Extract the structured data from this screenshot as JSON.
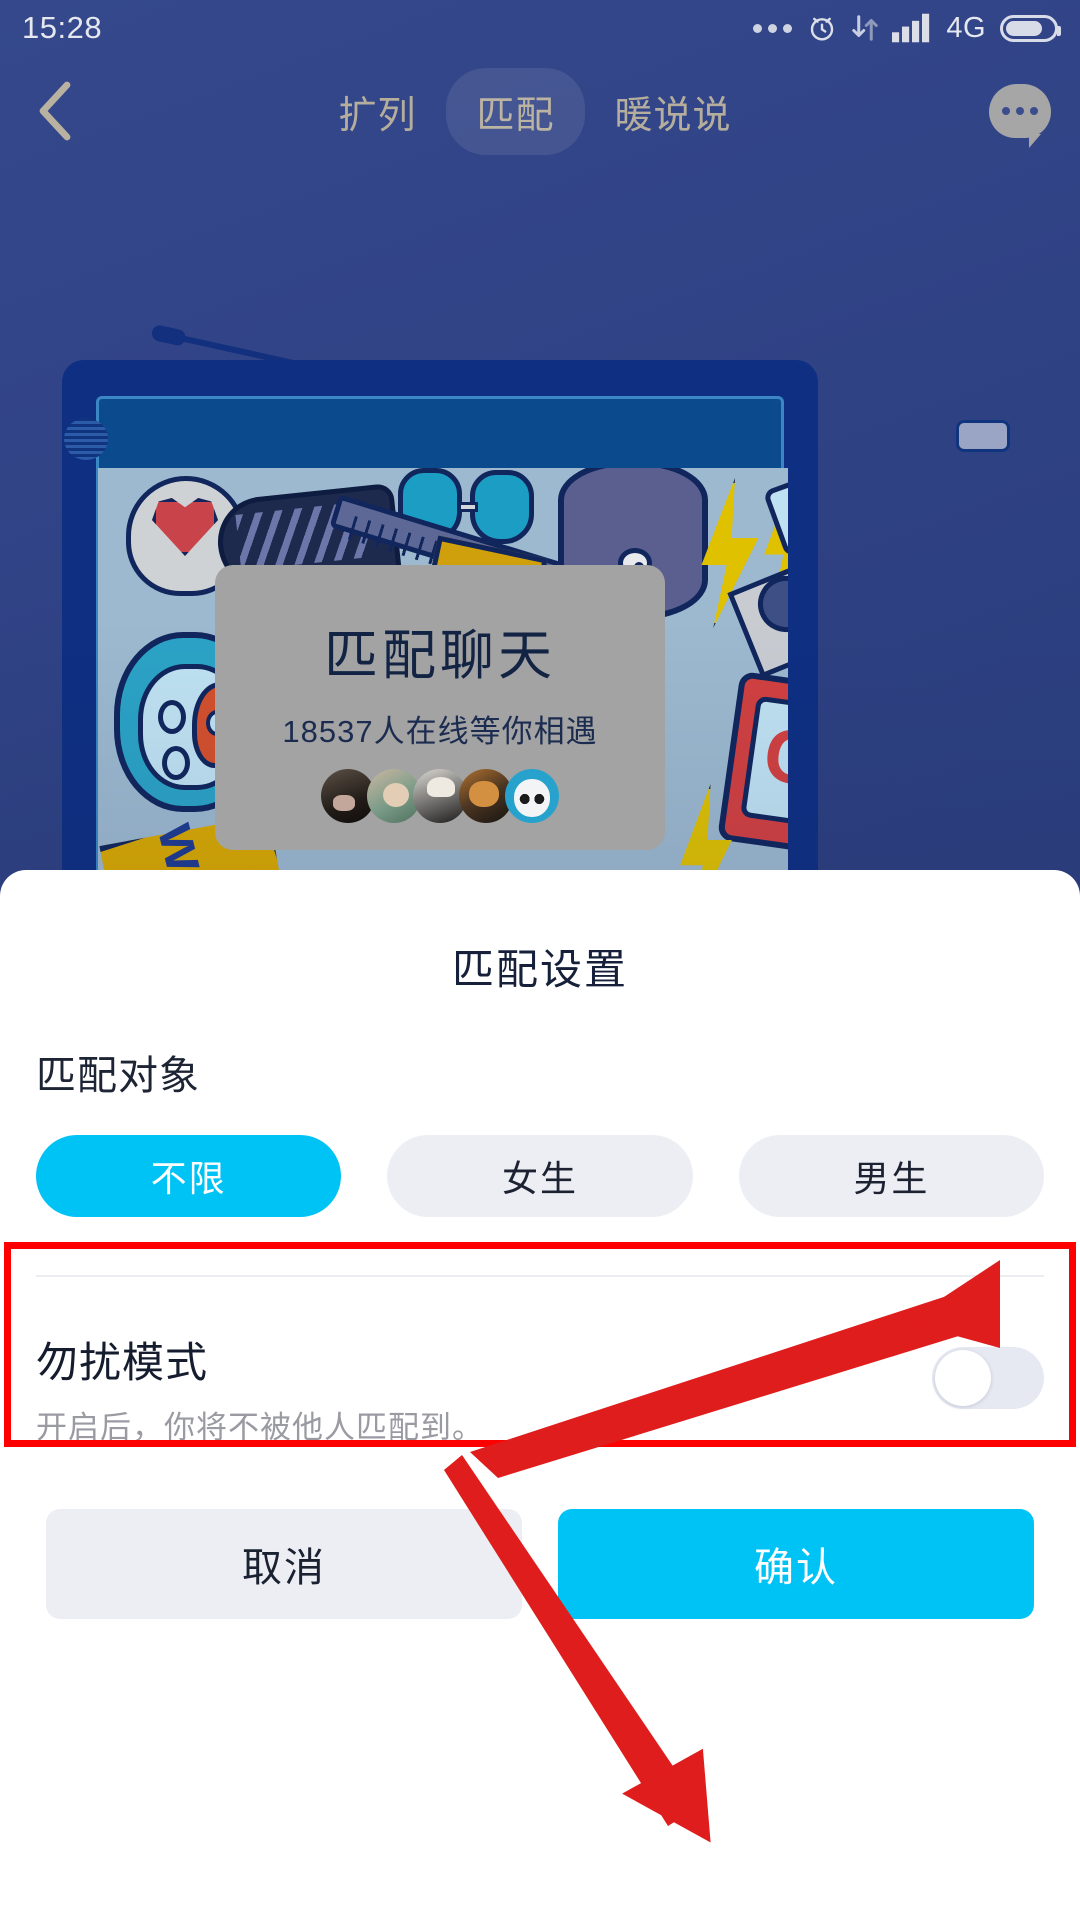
{
  "status_bar": {
    "time": "15:28",
    "icons": [
      "more-dots-icon",
      "alarm-clock-icon",
      "data-transfer-icon",
      "signal-bars-icon",
      "battery-icon"
    ],
    "network": "4G"
  },
  "nav": {
    "back_icon": "back-chevron-icon",
    "more_icon": "chat-bubble-more-icon",
    "tabs": [
      {
        "label": "扩列",
        "active": false
      },
      {
        "label": "匹配",
        "active": true
      },
      {
        "label": "暖说说",
        "active": false
      }
    ]
  },
  "promo_card": {
    "title": "匹配聊天",
    "subtitle": "18537人在线等你相遇",
    "online_count": "18537",
    "avatar_count": 5
  },
  "sheet": {
    "title": "匹配设置",
    "match_target": {
      "label": "匹配对象",
      "options": [
        {
          "label": "不限",
          "selected": true
        },
        {
          "label": "女生",
          "selected": false
        },
        {
          "label": "男生",
          "selected": false
        }
      ]
    },
    "dnd": {
      "title": "勿扰模式",
      "subtitle": "开启后，你将不被他人匹配到。",
      "enabled": false
    },
    "buttons": {
      "cancel": "取消",
      "confirm": "确认"
    }
  },
  "colors": {
    "accent_cyan": "#00c3f5",
    "chip_idle": "#eceef3",
    "annotation_red": "#fe0000",
    "arrow_red": "#e01d1d",
    "app_bg_blue": "#2e4183",
    "sheet_bg": "#ffffff"
  },
  "annotations": {
    "highlight_box": "match-target-section",
    "arrow_targets": [
      "dnd-toggle",
      "confirm-button"
    ]
  }
}
